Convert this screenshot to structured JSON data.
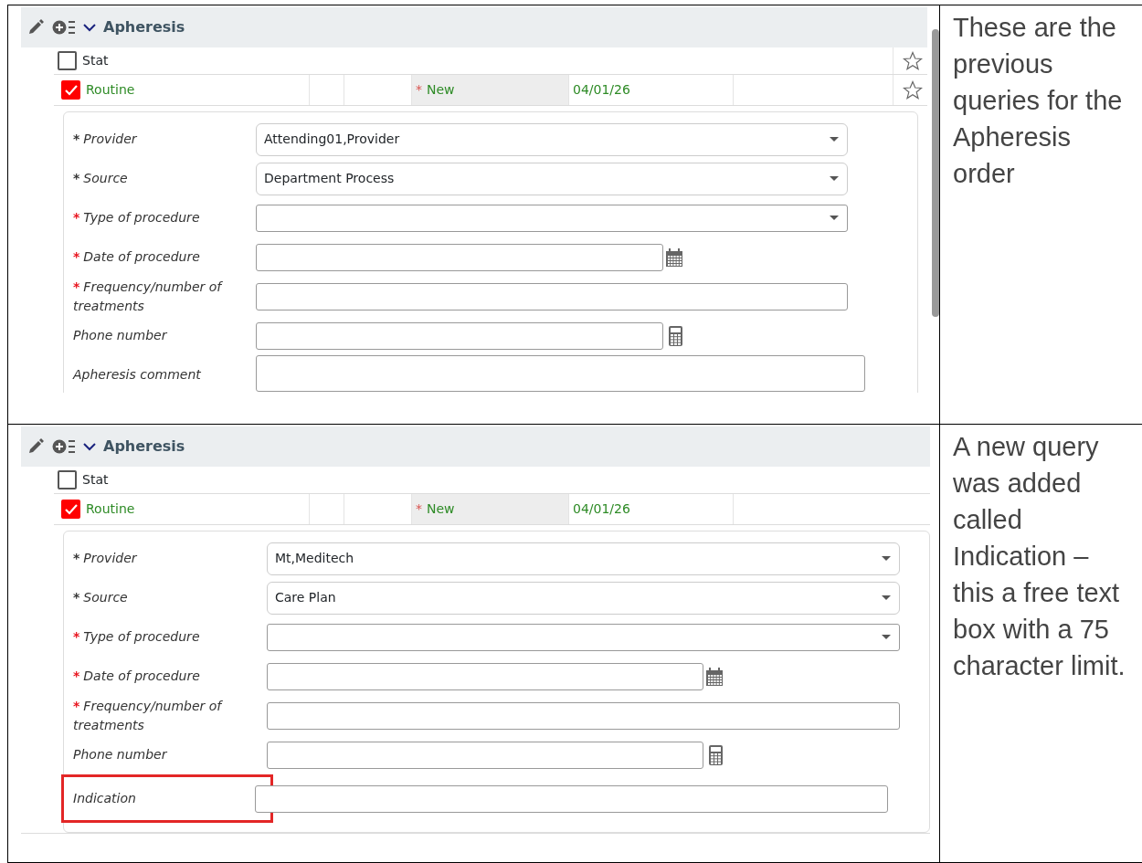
{
  "rows": [
    {
      "panel": {
        "title": "Apheresis",
        "scrollbar": true,
        "stars": true,
        "priorities": [
          {
            "label": "Stat",
            "checked": false
          },
          {
            "label": "Routine",
            "checked": true,
            "asterisk": "*",
            "status": "New",
            "date": "04/01/26"
          }
        ],
        "fields": [
          {
            "kind": "select",
            "asterisk": "*",
            "asterisk_alert": false,
            "label": "Provider",
            "value": "Attending01,Provider",
            "highlighted": false
          },
          {
            "kind": "select",
            "asterisk": "*",
            "asterisk_alert": false,
            "label": "Source",
            "value": "Department Process",
            "highlighted": false
          },
          {
            "kind": "dropdown",
            "asterisk": "*",
            "asterisk_alert": true,
            "label": "Type of procedure",
            "highlighted": false
          },
          {
            "kind": "date",
            "asterisk": "*",
            "asterisk_alert": true,
            "label": "Date of procedure",
            "highlighted": false
          },
          {
            "kind": "text",
            "asterisk": "*",
            "asterisk_alert": true,
            "label": "Frequency/number of treatments",
            "highlighted": false
          },
          {
            "kind": "phone",
            "label": "Phone number",
            "highlighted": false
          },
          {
            "kind": "textarea",
            "label": "Apheresis comment",
            "highlighted": false
          }
        ]
      },
      "note": "These are the previous queries for the Apheresis order"
    },
    {
      "panel": {
        "title": "Apheresis",
        "scrollbar": false,
        "stars": false,
        "priorities": [
          {
            "label": "Stat",
            "checked": false
          },
          {
            "label": "Routine",
            "checked": true,
            "asterisk": "*",
            "status": "New",
            "date": "04/01/26"
          }
        ],
        "fields": [
          {
            "kind": "select",
            "asterisk": "*",
            "asterisk_alert": false,
            "label": "Provider",
            "value": "Mt,Meditech",
            "highlighted": false
          },
          {
            "kind": "select",
            "asterisk": "*",
            "asterisk_alert": false,
            "label": "Source",
            "value": "Care Plan",
            "highlighted": false
          },
          {
            "kind": "dropdown",
            "asterisk": "*",
            "asterisk_alert": true,
            "label": "Type of procedure",
            "highlighted": false
          },
          {
            "kind": "date",
            "asterisk": "*",
            "asterisk_alert": true,
            "label": "Date of procedure",
            "highlighted": false
          },
          {
            "kind": "text",
            "asterisk": "*",
            "asterisk_alert": true,
            "label": "Frequency/number of treatments",
            "highlighted": false
          },
          {
            "kind": "phone",
            "label": "Phone number",
            "highlighted": false
          },
          {
            "kind": "text",
            "label": "Indication",
            "highlighted": true
          }
        ]
      },
      "note": "A new query was added called Indication – this a free text box with a 75 character limit."
    }
  ]
}
